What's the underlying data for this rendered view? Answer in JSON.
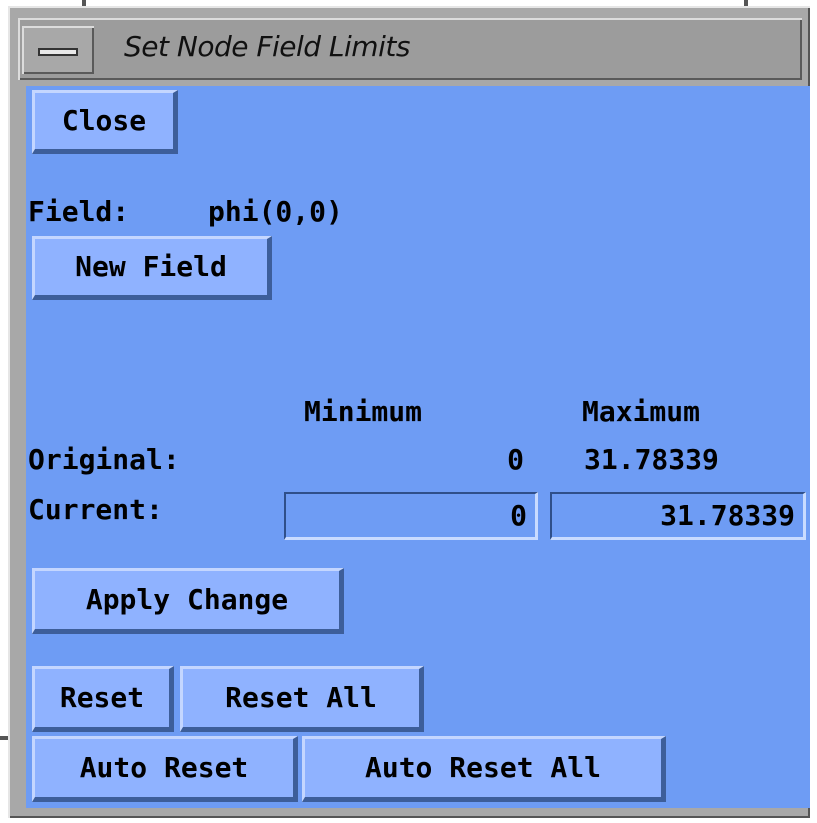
{
  "window": {
    "title": "Set Node Field Limits"
  },
  "buttons": {
    "close": "Close",
    "new_field": "New Field",
    "apply_change": "Apply Change",
    "reset": "Reset",
    "reset_all": "Reset All",
    "auto_reset": "Auto Reset",
    "auto_reset_all": "Auto Reset All"
  },
  "field": {
    "label": "Field:",
    "value": "phi(0,0)"
  },
  "limits": {
    "min_header": "Minimum",
    "max_header": "Maximum",
    "original_label": "Original:",
    "original_min": "0",
    "original_max": "31.78339",
    "current_label": "Current:",
    "current_min": "0",
    "current_max": "31.78339"
  },
  "colors": {
    "panel": "#6e9cf4",
    "button": "#8fb2ff",
    "titlebar": "#9c9c9c"
  }
}
